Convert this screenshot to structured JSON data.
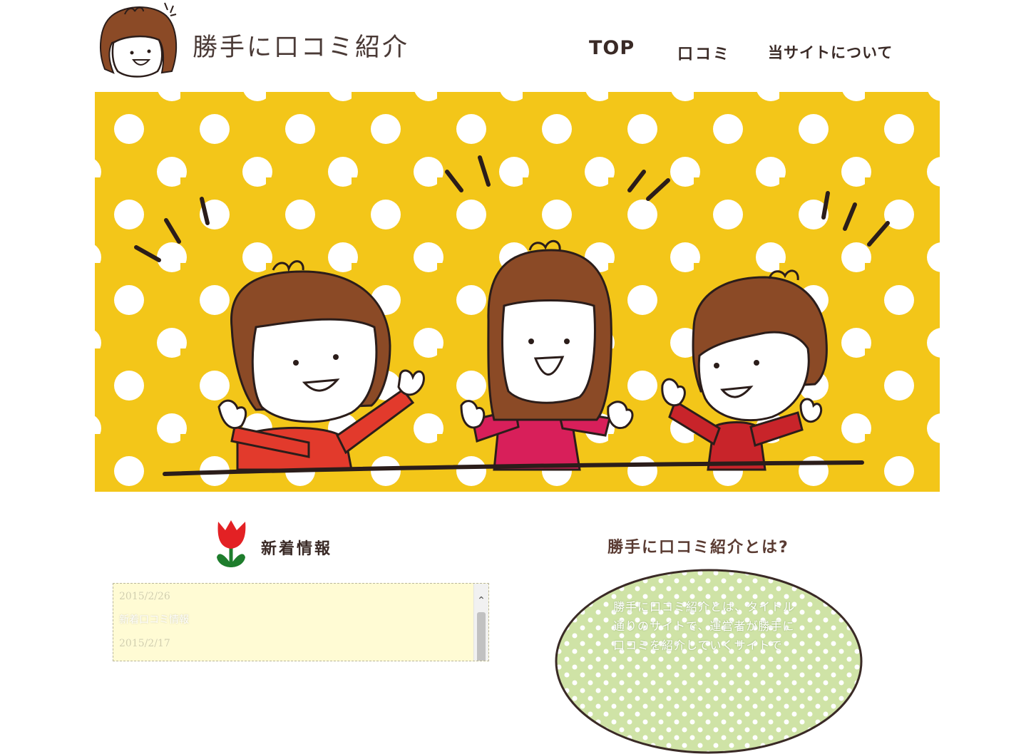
{
  "header": {
    "site_title": "勝手に口コミ紹介",
    "nav": {
      "top": "TOP",
      "kuchikomi": "口コミ",
      "about": "当サイトについて"
    }
  },
  "news": {
    "heading": "新着情報",
    "items": [
      {
        "date": "2015/2/26",
        "title": "新着口コミ情報"
      },
      {
        "date": "2015/2/17",
        "title": ""
      }
    ]
  },
  "about": {
    "heading": "勝手に口コミ紹介とは?",
    "text": "勝手に口コミ紹介とは、タイトル通りのサイトで、運営者が勝手に口コミを紹介していくサイトで"
  },
  "colors": {
    "hero_background": "#f3c619",
    "dot": "#ffffff",
    "hair": "#8b4a26",
    "outline": "#2b1d1a",
    "shirt_left": "#e23a2c",
    "shirt_center": "#d81f5a",
    "shirt_right": "#c8242a",
    "about_green": "#cfe3a6",
    "news_bg": "#fffbd4"
  }
}
